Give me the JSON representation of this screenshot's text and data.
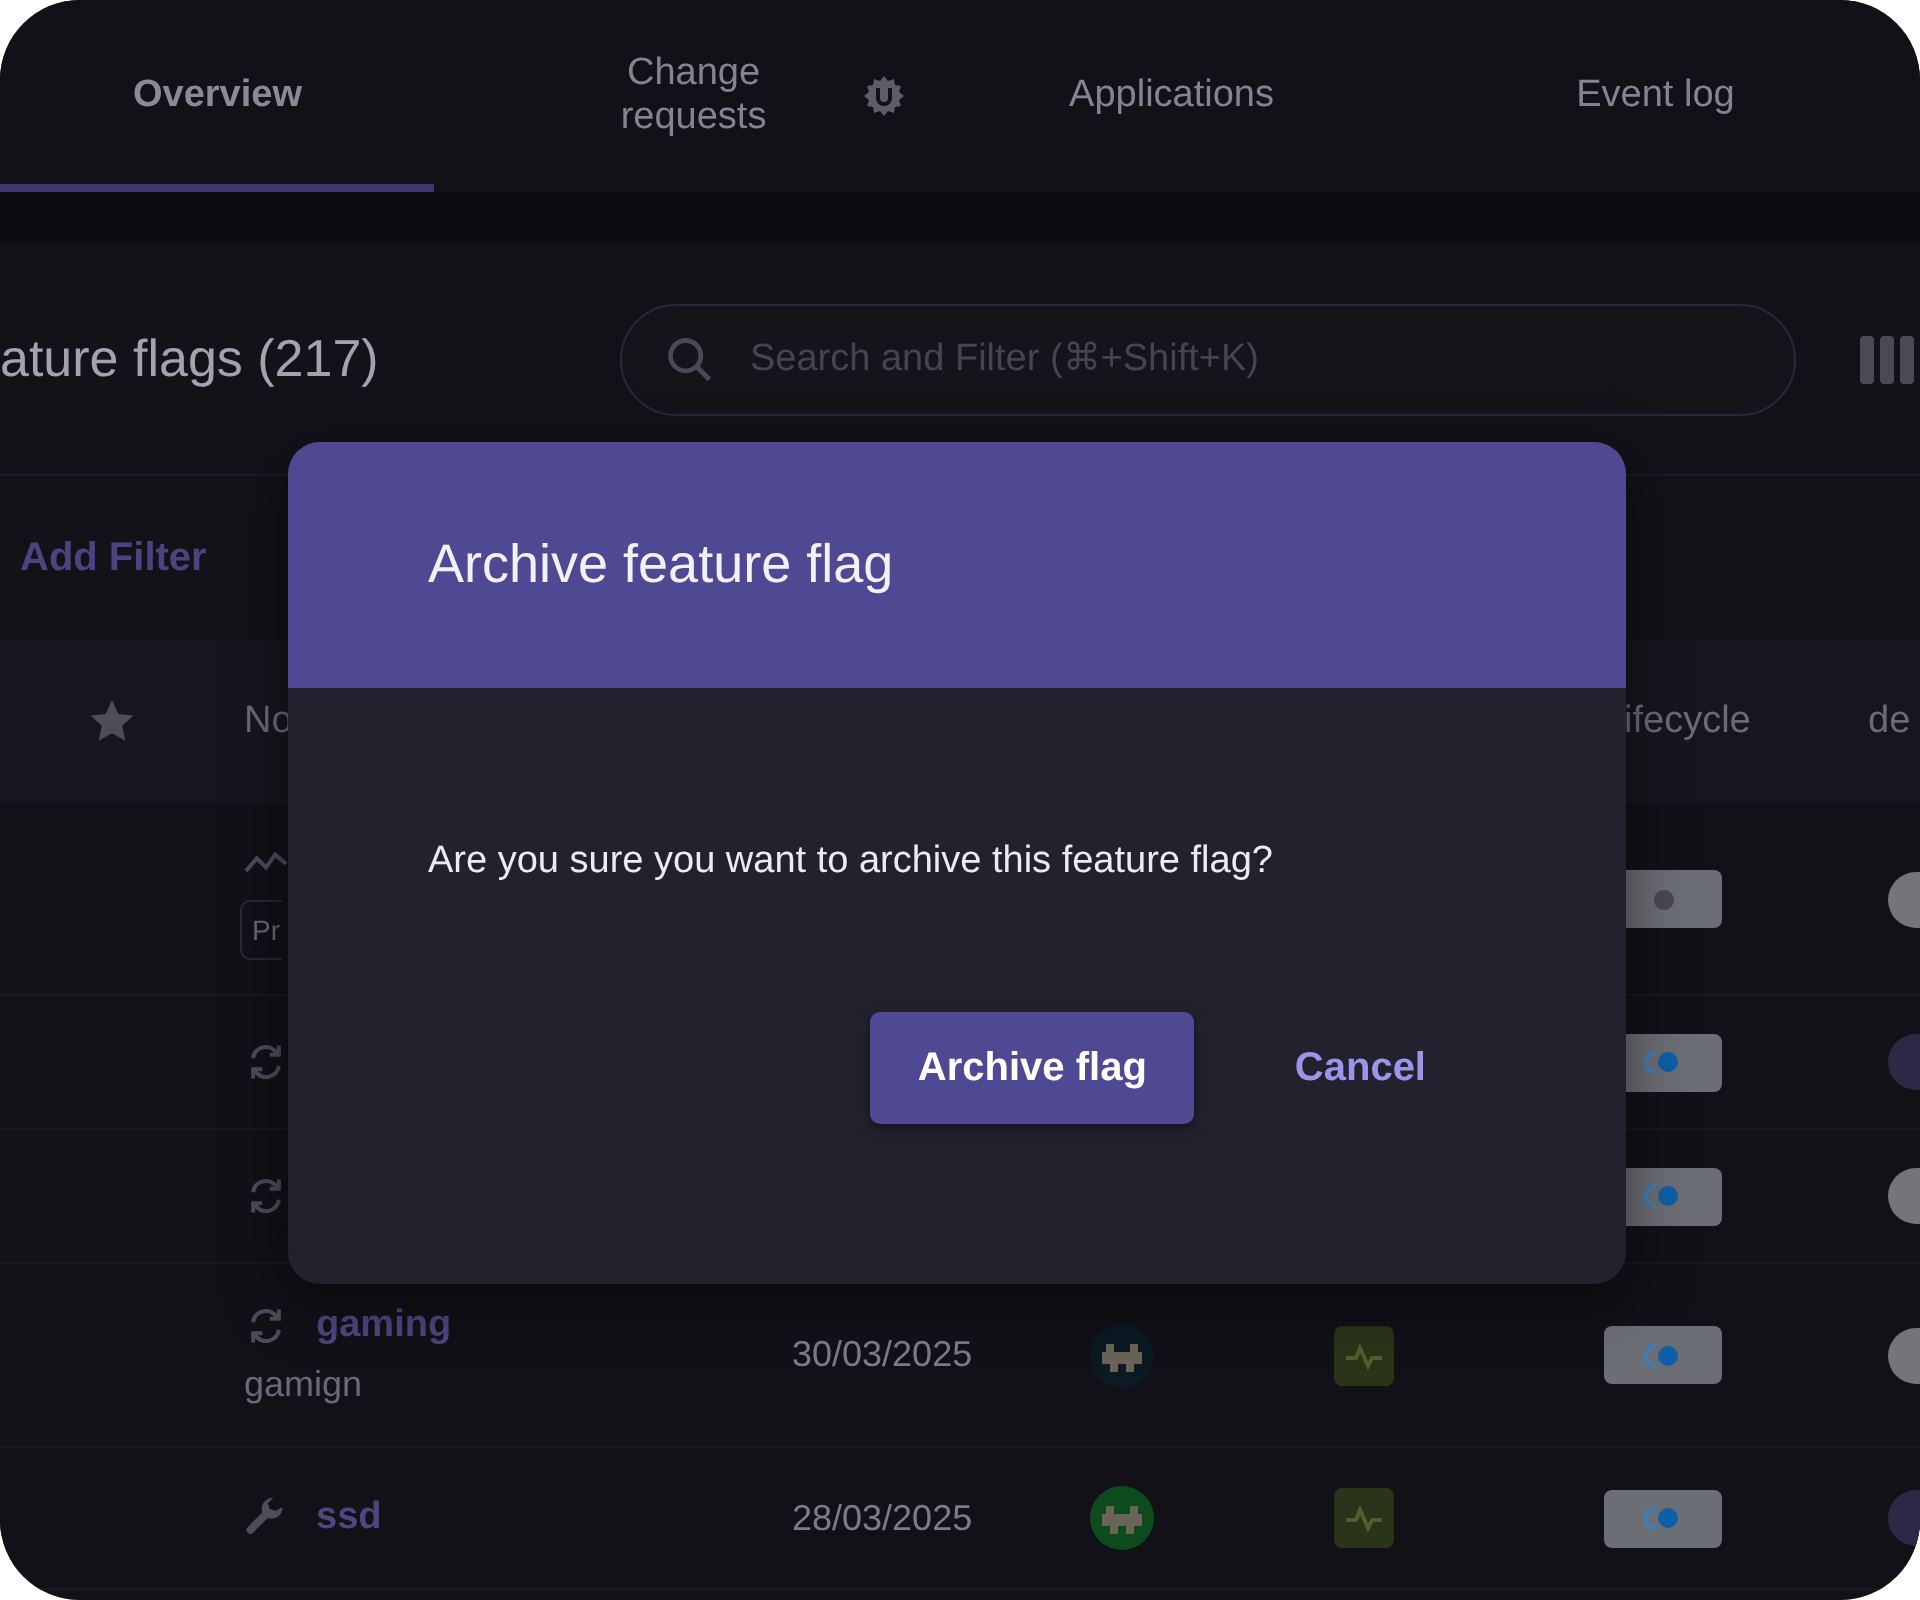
{
  "tabs": [
    {
      "label": "Overview",
      "selected": true,
      "icon": false
    },
    {
      "label": "Change requests",
      "selected": false,
      "icon": true
    },
    {
      "label": "Applications",
      "selected": false,
      "icon": false
    },
    {
      "label": "Event log",
      "selected": false,
      "icon": false
    }
  ],
  "header": {
    "title": "ature flags (217)",
    "search": {
      "placeholder": "Search and Filter (⌘+Shift+K)"
    }
  },
  "filters": {
    "add_filter": "Add Filter"
  },
  "table": {
    "columns": [
      {
        "kind": "star"
      },
      {
        "kind": "text",
        "label": "No"
      },
      {
        "kind": "text",
        "label": "ifecycle"
      },
      {
        "kind": "text",
        "label": "de"
      }
    ],
    "rows": [
      {
        "kind": "experiment",
        "tag": "Pr",
        "lifecycle": {
          "kind": "initial"
        },
        "enabled": false
      },
      {
        "kind": "release",
        "lifecycle": {
          "kind": "live"
        },
        "enabled": true
      },
      {
        "kind": "release",
        "lifecycle": {
          "kind": "live"
        },
        "enabled": false
      },
      {
        "kind": "release",
        "name": "gaming",
        "description": "gamign",
        "created": "30/03/2025",
        "avatar": {
          "color": "#0c1a24"
        },
        "health": {
          "kind": "healthy"
        },
        "lifecycle": {
          "kind": "live"
        },
        "enabled": false
      },
      {
        "kind": "operational",
        "name": "ssd",
        "created": "28/03/2025",
        "avatar": {
          "color": "#0d4a1c"
        },
        "health": {
          "kind": "healthy"
        },
        "lifecycle": {
          "kind": "live"
        },
        "enabled": true
      }
    ]
  },
  "dialog": {
    "title": "Archive feature flag",
    "message": "Are you sure you want to archive this feature flag?",
    "buttons": [
      {
        "label": "Archive flag",
        "kind": "primary"
      },
      {
        "label": "Cancel",
        "kind": "text"
      }
    ]
  }
}
